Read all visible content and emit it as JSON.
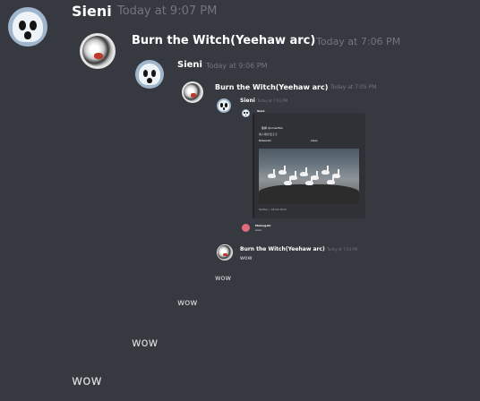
{
  "messages": [
    {
      "author": "Sieni",
      "timestamp": "Today at 9:07 PM",
      "text": "wow"
    },
    {
      "author": "Burn the Witch(Yeehaw arc)",
      "timestamp": "Today at 7:06 PM",
      "text": "wow"
    },
    {
      "author": "Sieni",
      "timestamp": "Today at 9:06 PM",
      "text": "wow"
    },
    {
      "author": "Burn the Witch(Yeehaw arc)",
      "timestamp": "Today at 7:05 PM",
      "text": "wow"
    },
    {
      "author": "Sieni",
      "timestamp": "Today at 7:03 PM"
    },
    {
      "author": "Burn the Witch(Yeehaw arc)",
      "timestamp": "Today at 7:04 PM",
      "text": "wow"
    }
  ],
  "embed": {
    "author": "Sieni",
    "link": "https://twitter.com/omanfish",
    "tweet_author": "魚卵 @omanfish",
    "tweet_text": "鳩人間が出るそ",
    "retweets_label": "Retweets",
    "likes_label": "Likes",
    "footer": "Twitter • 02.04.2022",
    "reply_author": "Mamegaki",
    "reply_text": "wow"
  },
  "colors": {
    "background": "#36393f",
    "username": "#ffffff",
    "timestamp": "#72767d",
    "text": "#dcddde",
    "link": "#00aff4"
  },
  "icons": {
    "sieni_avatar": "ghost-avatar-icon",
    "witch_avatar": "witch-avatar-icon"
  }
}
